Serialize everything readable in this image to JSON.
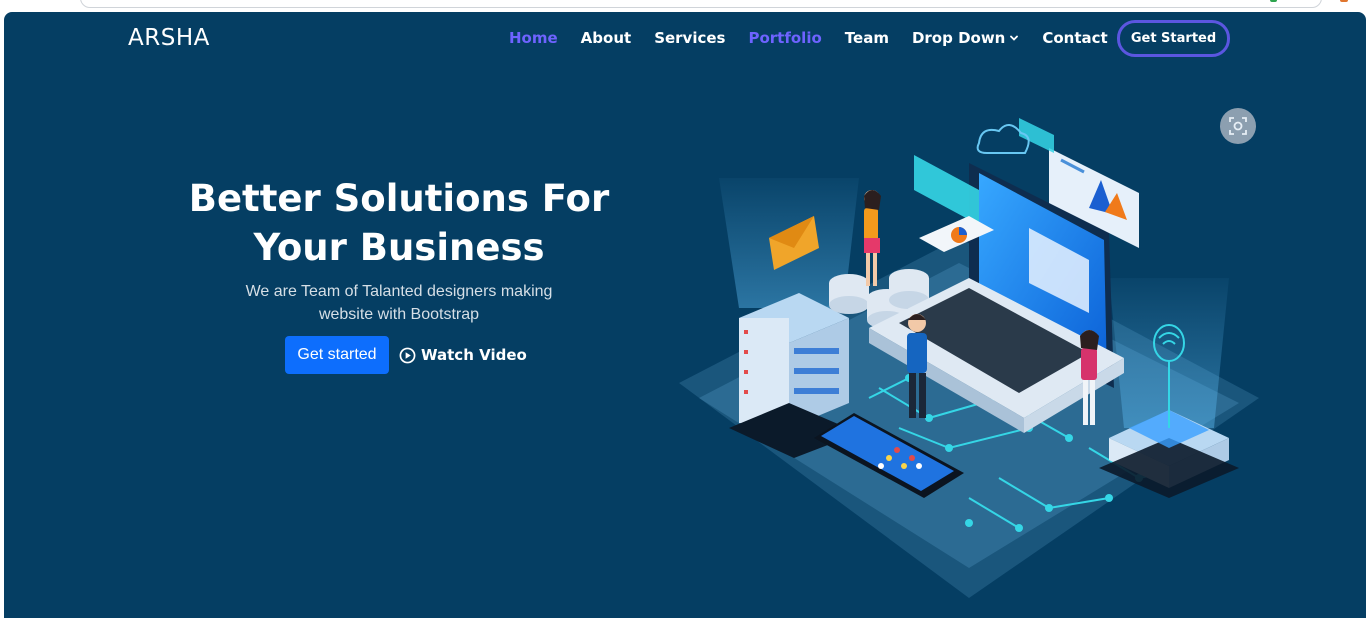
{
  "header": {
    "logo": "ARSHA",
    "nav": [
      {
        "label": "Home",
        "active": true
      },
      {
        "label": "About",
        "active": false
      },
      {
        "label": "Services",
        "active": false
      },
      {
        "label": "Portfolio",
        "active": true
      },
      {
        "label": "Team",
        "active": false
      },
      {
        "label": "Drop Down",
        "active": false,
        "dropdown": true
      },
      {
        "label": "Contact",
        "active": false
      }
    ],
    "cta_label": "Get Started"
  },
  "hero": {
    "title_line1": "Better Solutions For",
    "title_line2": "Your Business",
    "subtitle_line1": "We are Team of Talanted designers making",
    "subtitle_line2": "website with Bootstrap",
    "primary_button": "Get started",
    "video_button": "Watch Video"
  },
  "icons": {
    "video": "play-circle-icon",
    "dropdown": "chevron-down-icon",
    "scan": "screen-capture-icon"
  },
  "colors": {
    "background": "#053e63",
    "accent": "#6e63ff",
    "primary_button": "#0d6efd",
    "cta_border": "#5b56e0"
  }
}
